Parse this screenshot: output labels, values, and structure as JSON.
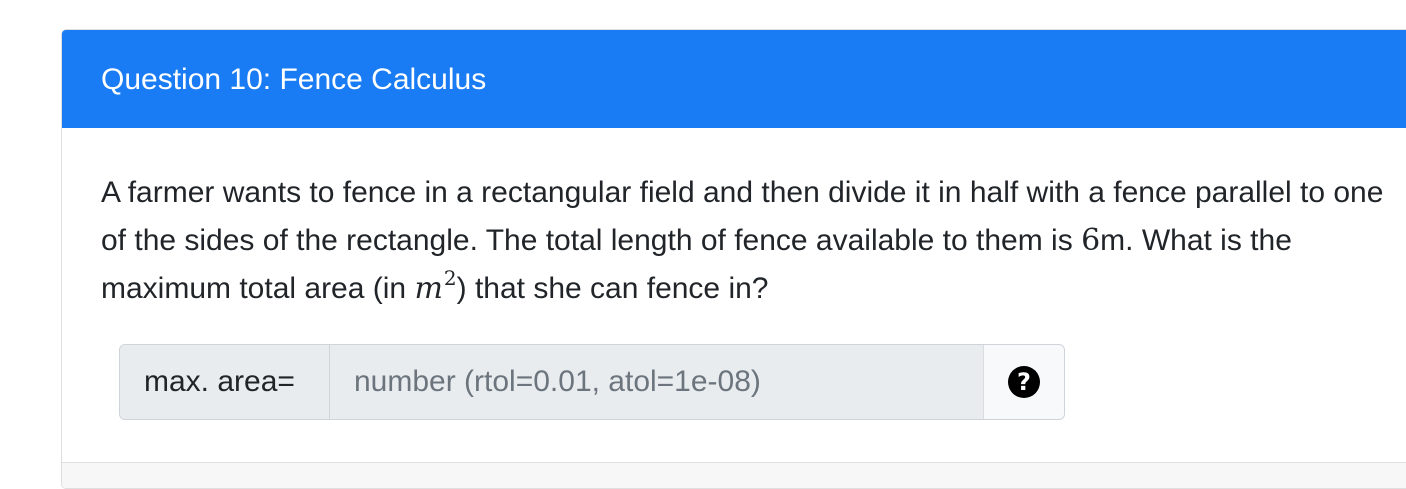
{
  "question": {
    "title": "Question 10: Fence Calculus",
    "text_part1": "A farmer wants to fence in a rectangular field and then divide it in half with a fence parallel to one of the sides of the rectangle. The total length of fence available to them is ",
    "number": "6",
    "text_part2": "m. What is the maximum total area (in ",
    "math_var": "m",
    "math_exp": "2",
    "text_part3": ") that she can fence in?"
  },
  "answer": {
    "label": "max. area=",
    "value": "",
    "placeholder": "number (rtol=0.01, atol=1e-08)",
    "help_icon": "question-circle-icon",
    "help_glyph": "?"
  },
  "colors": {
    "header_bg": "#1a7cf5",
    "header_text": "#ffffff",
    "input_bg": "#e9ecef"
  }
}
